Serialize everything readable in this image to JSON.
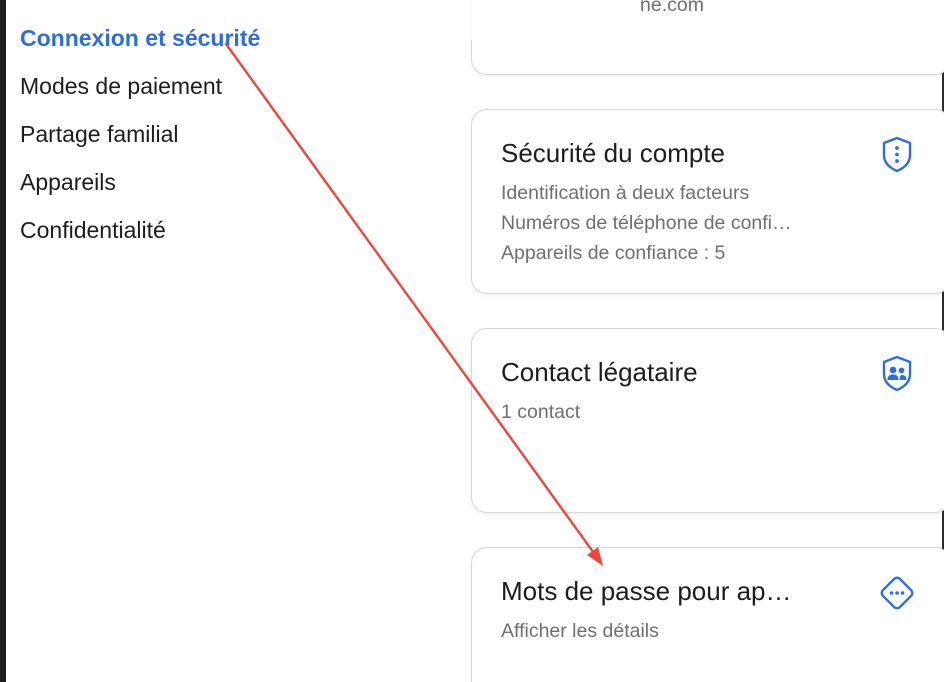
{
  "sidebar": {
    "items": [
      {
        "label": "Connexion et sécurité",
        "active": true
      },
      {
        "label": "Modes de paiement"
      },
      {
        "label": "Partage familial"
      },
      {
        "label": "Appareils"
      },
      {
        "label": "Confidentialité"
      }
    ]
  },
  "main": {
    "top_card": {
      "partial_text": "ne.com"
    },
    "cards": [
      {
        "title": "Sécurité du compte",
        "lines": [
          "Identification à deux facteurs",
          "Numéros de téléphone de confi…",
          "Appareils de confiance : 5"
        ],
        "icon": "shield-dots-icon"
      },
      {
        "title": "Contact légataire",
        "lines": [
          "1 contact"
        ],
        "icon": "shield-people-icon"
      },
      {
        "title": "Mots de passe pour ap…",
        "lines": [
          "Afficher les détails"
        ],
        "icon": "diamond-dots-icon"
      }
    ]
  },
  "colors": {
    "accent": "#2f6ed8",
    "annotation_arrow": "#e8493a",
    "text_primary": "#1d1d1f",
    "text_secondary": "#6e6e73"
  }
}
